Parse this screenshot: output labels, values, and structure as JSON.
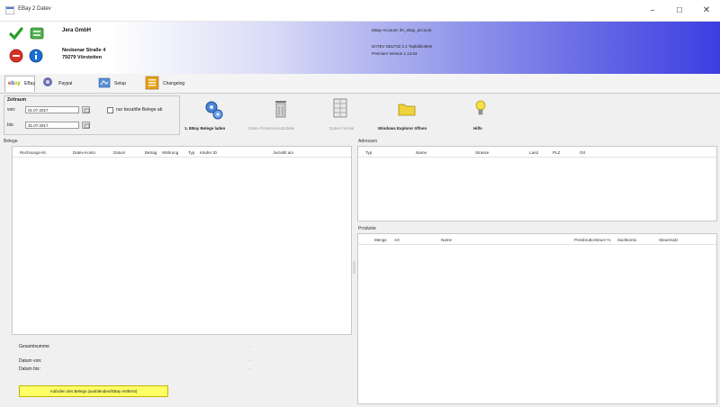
{
  "window": {
    "title": "EBay 2 Datev",
    "controls": {
      "minimize": "–",
      "maximize": "☐",
      "close": "✕"
    }
  },
  "header": {
    "company_name": "Jera GmbH",
    "street": "Nesbenar Straße 4",
    "city": "79279 Vörstetten",
    "account_line": "EBay-Account: ihr_ebay_account",
    "datev_line": "DATEV SELF32 2.1 Topbibliothek",
    "version_line": "Premium Version 1.14.04"
  },
  "tabs": [
    {
      "label": "EBay",
      "logo": "ebay"
    },
    {
      "label": "Paypal"
    },
    {
      "label": "Setup"
    },
    {
      "label": "Changelog"
    }
  ],
  "zeitraum": {
    "title": "Zeitraum",
    "from_label": "von:",
    "from_value": "01.07.2017",
    "to_label": "bis:",
    "to_value": "31.07.2017",
    "checkbox_label": "nur bezahlte Belege ab"
  },
  "toolbar": {
    "load": "1. EBay Belege laden",
    "posting": "Datev Postenumsatzdatei",
    "format": "Datev Format",
    "explorer": "Windows Explorer öffnen",
    "help": "Hilfe"
  },
  "belege": {
    "title": "Belege",
    "columns": [
      "Rechnungs-Nr.",
      "Datev-Konto",
      "Datum",
      "Betrag",
      "Währung",
      "Typ",
      "Käufer ID",
      "bezahlt am"
    ],
    "summary_label": "Gesamtsumme",
    "summary_value": "-",
    "date_from_label": "Datum von:",
    "date_from_value": "-",
    "date_to_label": "Datum bis:",
    "date_to_value": "-",
    "yellow_button": "Aufrufen des Belegs (ausblenden/EBay entfernt)"
  },
  "adressen": {
    "title": "Adressen",
    "columns": [
      "Typ",
      "Name",
      "Strasse",
      "Land",
      "PLZ",
      "Ort"
    ]
  },
  "produkte": {
    "title": "Produkte",
    "columns": [
      "Menge",
      "Art",
      "Name",
      "Preisbrutto",
      "Steuer %",
      "Sachkonto",
      "Steuersatz"
    ]
  },
  "colors": {
    "banner_end": "#3c3ee0",
    "yellow_button": "#ffff66"
  }
}
